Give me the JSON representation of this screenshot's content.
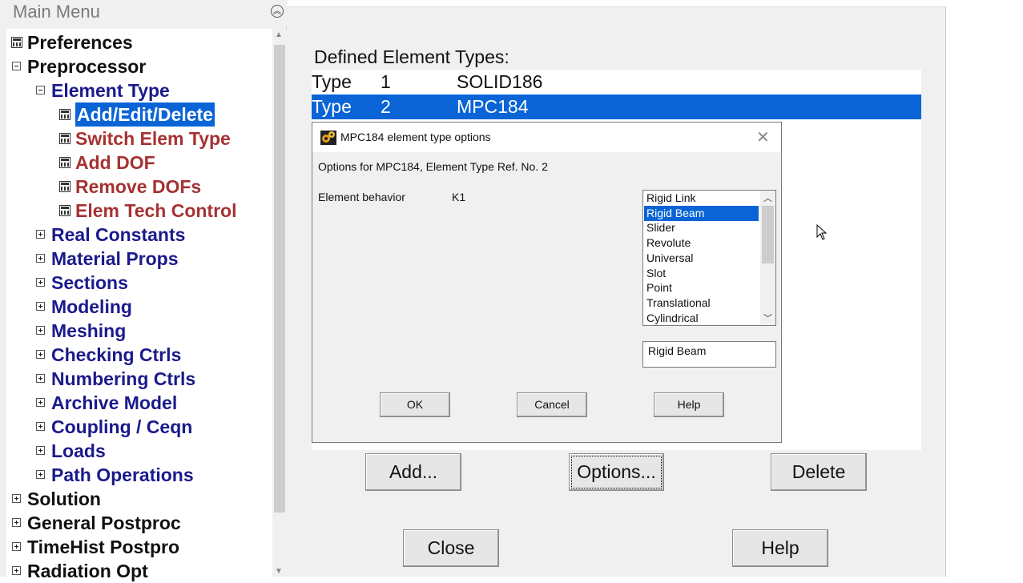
{
  "main_menu": {
    "title": "Main Menu",
    "collapse_icon": "collapse-all-icon",
    "items": [
      {
        "label": "Preferences",
        "level": 0,
        "icon": "calculator-icon",
        "color": "black"
      },
      {
        "label": "Preprocessor",
        "level": 0,
        "icon": "collapse-icon",
        "color": "black"
      },
      {
        "label": "Element Type",
        "level": 1,
        "icon": "collapse-icon",
        "color": "navy"
      },
      {
        "label": "Add/Edit/Delete",
        "level": 2,
        "icon": "calculator-icon",
        "color": "selected"
      },
      {
        "label": "Switch Elem Type",
        "level": 2,
        "icon": "calculator-icon",
        "color": "red"
      },
      {
        "label": "Add DOF",
        "level": 2,
        "icon": "calculator-icon",
        "color": "red"
      },
      {
        "label": "Remove DOFs",
        "level": 2,
        "icon": "calculator-icon",
        "color": "red"
      },
      {
        "label": "Elem Tech Control",
        "level": 2,
        "icon": "calculator-icon",
        "color": "red"
      },
      {
        "label": "Real Constants",
        "level": 1,
        "icon": "expand-icon",
        "color": "navy"
      },
      {
        "label": "Material Props",
        "level": 1,
        "icon": "expand-icon",
        "color": "navy"
      },
      {
        "label": "Sections",
        "level": 1,
        "icon": "expand-icon",
        "color": "navy"
      },
      {
        "label": "Modeling",
        "level": 1,
        "icon": "expand-icon",
        "color": "navy"
      },
      {
        "label": "Meshing",
        "level": 1,
        "icon": "expand-icon",
        "color": "navy"
      },
      {
        "label": "Checking Ctrls",
        "level": 1,
        "icon": "expand-icon",
        "color": "navy"
      },
      {
        "label": "Numbering Ctrls",
        "level": 1,
        "icon": "expand-icon",
        "color": "navy"
      },
      {
        "label": "Archive Model",
        "level": 1,
        "icon": "expand-icon",
        "color": "navy"
      },
      {
        "label": "Coupling / Ceqn",
        "level": 1,
        "icon": "expand-icon",
        "color": "navy"
      },
      {
        "label": "Loads",
        "level": 1,
        "icon": "expand-icon",
        "color": "navy"
      },
      {
        "label": "Path Operations",
        "level": 1,
        "icon": "expand-icon",
        "color": "navy"
      },
      {
        "label": "Solution",
        "level": 0,
        "icon": "expand-icon",
        "color": "black"
      },
      {
        "label": "General Postproc",
        "level": 0,
        "icon": "expand-icon",
        "color": "black"
      },
      {
        "label": "TimeHist Postpro",
        "level": 0,
        "icon": "expand-icon",
        "color": "black"
      },
      {
        "label": "Radiation Opt",
        "level": 0,
        "icon": "expand-icon",
        "color": "black"
      }
    ]
  },
  "element_types": {
    "label": "Defined Element Types:",
    "rows": [
      {
        "type": "Type",
        "num": "1",
        "name": "SOLID186",
        "selected": false
      },
      {
        "type": "Type",
        "num": "2",
        "name": "MPC184",
        "selected": true
      }
    ],
    "buttons": {
      "add": "Add...",
      "options": "Options...",
      "delete": "Delete",
      "close": "Close",
      "help": "Help"
    }
  },
  "dialog": {
    "title": "MPC184 element type options",
    "icon": "ansys-gear-icon",
    "close_icon": "close-icon",
    "caption": "Options for MPC184, Element Type Ref. No. 2",
    "behavior_label": "Element behavior",
    "behavior_key": "K1",
    "options": [
      "Rigid Link",
      "Rigid Beam",
      "Slider",
      "Revolute",
      "Universal",
      "Slot",
      "Point",
      "Translational",
      "Cylindrical"
    ],
    "selected_option": "Rigid Beam",
    "selected_value": "Rigid Beam",
    "buttons": {
      "ok": "OK",
      "cancel": "Cancel",
      "help": "Help"
    }
  },
  "colors": {
    "selection": "#0a64d6",
    "tree_black": "#111111",
    "tree_navy": "#1a1a8c",
    "tree_red": "#a63232"
  }
}
